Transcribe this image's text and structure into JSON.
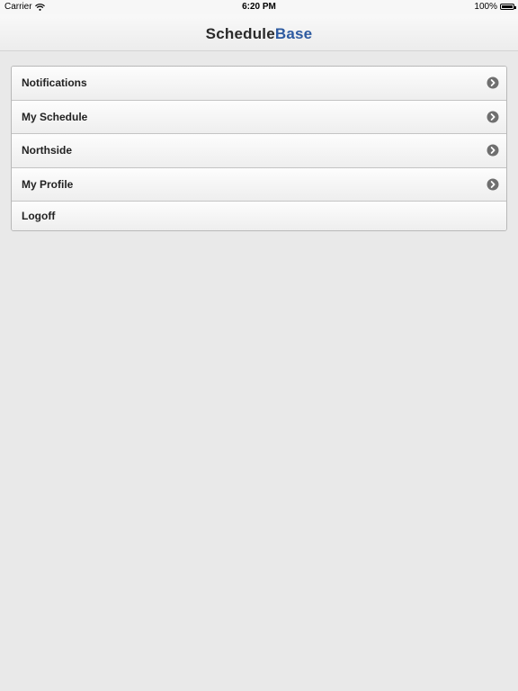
{
  "status_bar": {
    "carrier": "Carrier",
    "time": "6:20 PM",
    "battery": "100%"
  },
  "header": {
    "logo_part1": "Schedule",
    "logo_part2": "Base"
  },
  "colors": {
    "brand_dark": "#2a2a2a",
    "brand_blue": "#2d5aa0",
    "chevron": "#707070"
  },
  "menu": {
    "items": [
      {
        "label": "Notifications",
        "icon": "chevron-right-circle-icon"
      },
      {
        "label": "My Schedule",
        "icon": "chevron-right-circle-icon"
      },
      {
        "label": "Northside",
        "icon": "chevron-right-circle-icon"
      },
      {
        "label": "My Profile",
        "icon": "chevron-right-circle-icon"
      },
      {
        "label": "Logoff"
      }
    ]
  }
}
